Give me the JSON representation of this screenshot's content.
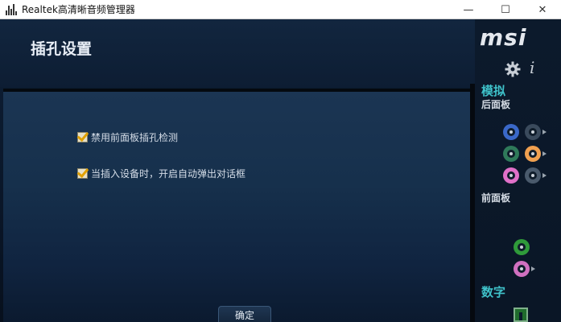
{
  "window": {
    "title": "Realtek高清晰音频管理器",
    "controls": {
      "minimize": "—",
      "maximize": "☐",
      "close": "✕"
    }
  },
  "page": {
    "title": "插孔设置"
  },
  "options": [
    {
      "label": "禁用前面板插孔检测",
      "checked": true
    },
    {
      "label": "当插入设备时，开启自动弹出对话框",
      "checked": true
    }
  ],
  "ok_button": {
    "label": "确定"
  },
  "sidebar": {
    "logo": "msi",
    "settings_icon": "gear-icon",
    "info_icon": "i",
    "analog": {
      "title": "模拟",
      "back_panel": {
        "title": "后面板",
        "jacks": [
          {
            "color": "#3a68c8",
            "active": true
          },
          {
            "color": "#3a4a5c",
            "active": false
          },
          {
            "color": "#2f7a5a",
            "active": true
          },
          {
            "color": "#f0a050",
            "active": true
          },
          {
            "color": "#e070c8",
            "active": true
          },
          {
            "color": "#4a5a6c",
            "active": false
          }
        ]
      },
      "front_panel": {
        "title": "前面板",
        "jacks": [
          {
            "color": "#2f9a3a",
            "active": true
          },
          {
            "color": "#d070c0",
            "active": true
          }
        ]
      }
    },
    "digital": {
      "title": "数字"
    }
  },
  "colors": {
    "accent_teal": "#3fc1c9",
    "checkmark": "#e0a000"
  }
}
